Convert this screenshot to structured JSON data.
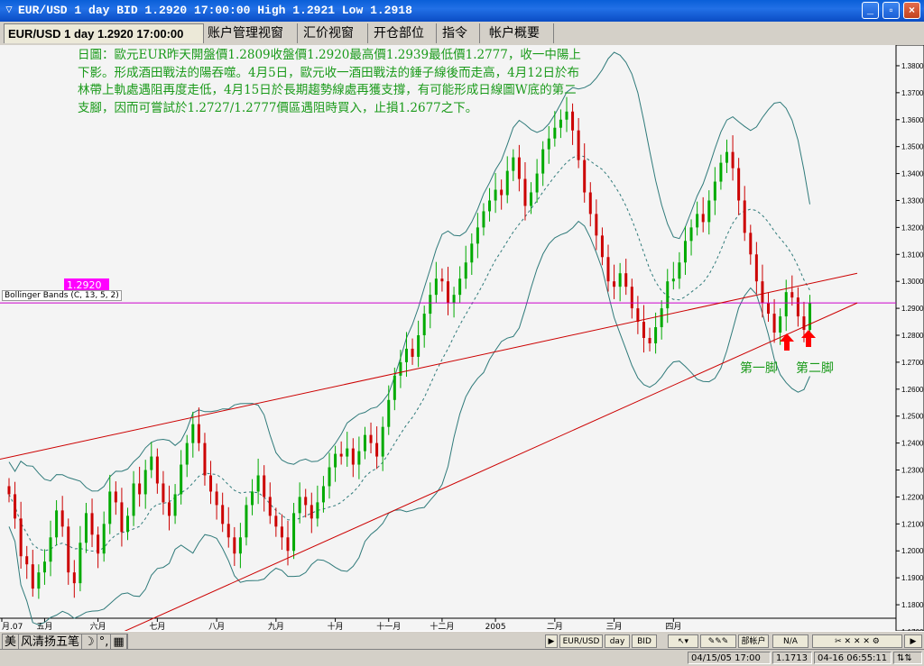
{
  "window": {
    "title": "EUR/USD 1 day BID 1.2920 17:00:00 High 1.2921 Low 1.2918",
    "buttons": {
      "minimize": "_",
      "restore": "▫",
      "close": "×"
    }
  },
  "tabs": [
    {
      "label": "EUR/USD 1 day 1.2920 17:00:00"
    },
    {
      "label": "账户管理视窗"
    },
    {
      "label": "汇价视窗"
    },
    {
      "label": "开仓部位"
    },
    {
      "label": "指令"
    },
    {
      "label": "帐户概要"
    }
  ],
  "annotation": {
    "text": "日圖：歐元EUR昨天開盤價1.2809收盤價1.2920最高價1.2939最低價1.2777，收一中陽上下影。形成酒田戰法的陽吞噬。4月5日，歐元收一酒田戰法的錘子線後而走高，4月12日於布林帶上軌處遇阻再度走低，4月15日於長期趨勢線處再獲支撐，有可能形成日線圖W底的第二支腳，因而可嘗試於1.2727/1.2777價區遇阻時買入，止損1.2677之下。",
    "first_leg": "第一脚",
    "second_leg": "第二脚"
  },
  "indicator": {
    "label": "Bollinger Bands (C, 13, 5, 2)",
    "current_price": "1.2920"
  },
  "chart_data": {
    "type": "candlestick",
    "instrument": "EUR/USD",
    "timeframe": "1 day",
    "last_close": 1.292,
    "ylim": [
      1.175,
      1.385
    ],
    "y_ticks": [
      "1.3800",
      "1.3700",
      "1.3600",
      "1.3500",
      "1.3400",
      "1.3300",
      "1.3200",
      "1.3100",
      "1.3000",
      "1.2900",
      "1.2800",
      "1.2700",
      "1.2600",
      "1.2500",
      "1.2400",
      "1.2300",
      "1.2200",
      "1.2100",
      "1.2000",
      "1.1900",
      "1.1800",
      "1.1700"
    ],
    "x_labels": [
      "月.07",
      "五月",
      "六月",
      "七月",
      "八月",
      "九月",
      "十月",
      "十一月",
      "十二月",
      "2005",
      "二月",
      "三月",
      "四月"
    ],
    "close_path": [
      1.221,
      1.212,
      1.198,
      1.195,
      1.186,
      1.192,
      1.196,
      1.205,
      1.215,
      1.209,
      1.192,
      1.188,
      1.203,
      1.214,
      1.206,
      1.199,
      1.21,
      1.222,
      1.218,
      1.207,
      1.213,
      1.225,
      1.221,
      1.23,
      1.235,
      1.225,
      1.218,
      1.213,
      1.221,
      1.232,
      1.24,
      1.247,
      1.24,
      1.228,
      1.222,
      1.217,
      1.21,
      1.205,
      1.199,
      1.205,
      1.217,
      1.222,
      1.228,
      1.22,
      1.213,
      1.209,
      1.205,
      1.2,
      1.214,
      1.22,
      1.217,
      1.212,
      1.218,
      1.224,
      1.231,
      1.236,
      1.235,
      1.238,
      1.232,
      1.237,
      1.243,
      1.24,
      1.235,
      1.246,
      1.256,
      1.265,
      1.27,
      1.275,
      1.272,
      1.28,
      1.288,
      1.295,
      1.301,
      1.3,
      1.292,
      1.295,
      1.301,
      1.307,
      1.314,
      1.32,
      1.326,
      1.33,
      1.334,
      1.332,
      1.341,
      1.346,
      1.338,
      1.328,
      1.333,
      1.34,
      1.349,
      1.353,
      1.357,
      1.36,
      1.363,
      1.356,
      1.345,
      1.333,
      1.325,
      1.317,
      1.309,
      1.3,
      1.298,
      1.303,
      1.298,
      1.29,
      1.285,
      1.279,
      1.277,
      1.283,
      1.29,
      1.3,
      1.301,
      1.307,
      1.315,
      1.32,
      1.325,
      1.322,
      1.33,
      1.337,
      1.344,
      1.348,
      1.342,
      1.33,
      1.318,
      1.31,
      1.3,
      1.292,
      1.288,
      1.281,
      1.287,
      1.296,
      1.294,
      1.287,
      1.282,
      1.292
    ],
    "bollinger": {
      "period": 13,
      "deviations": 2,
      "source": "C"
    },
    "trendlines": [
      {
        "from": [
          0,
          1.234
        ],
        "to": [
          1.0,
          1.303
        ],
        "color": "#cc0000"
      },
      {
        "from": [
          0.13,
          1.168
        ],
        "to": [
          1.0,
          1.292
        ],
        "color": "#cc0000"
      }
    ],
    "horizontal_line": {
      "value": 1.292,
      "color": "#cc00cc"
    }
  },
  "toolbar": {
    "ime": [
      "美",
      "风清扬五笔",
      "☽",
      "°,",
      "▦"
    ],
    "symbol": "EUR/USD",
    "timeframe": "day",
    "side": "BID",
    "account_label": "部帐户",
    "na": "N/A"
  },
  "status": {
    "datetime": "04/15/05 17:00",
    "value": "1.1713",
    "server_time": "04-16 06:55:11"
  },
  "colors": {
    "bull": "#00aa00",
    "bear": "#cc0000",
    "band": "#2f7a7a",
    "trend": "#cc0000",
    "price_line": "#cc00cc",
    "text_green": "#1a9a1a"
  }
}
